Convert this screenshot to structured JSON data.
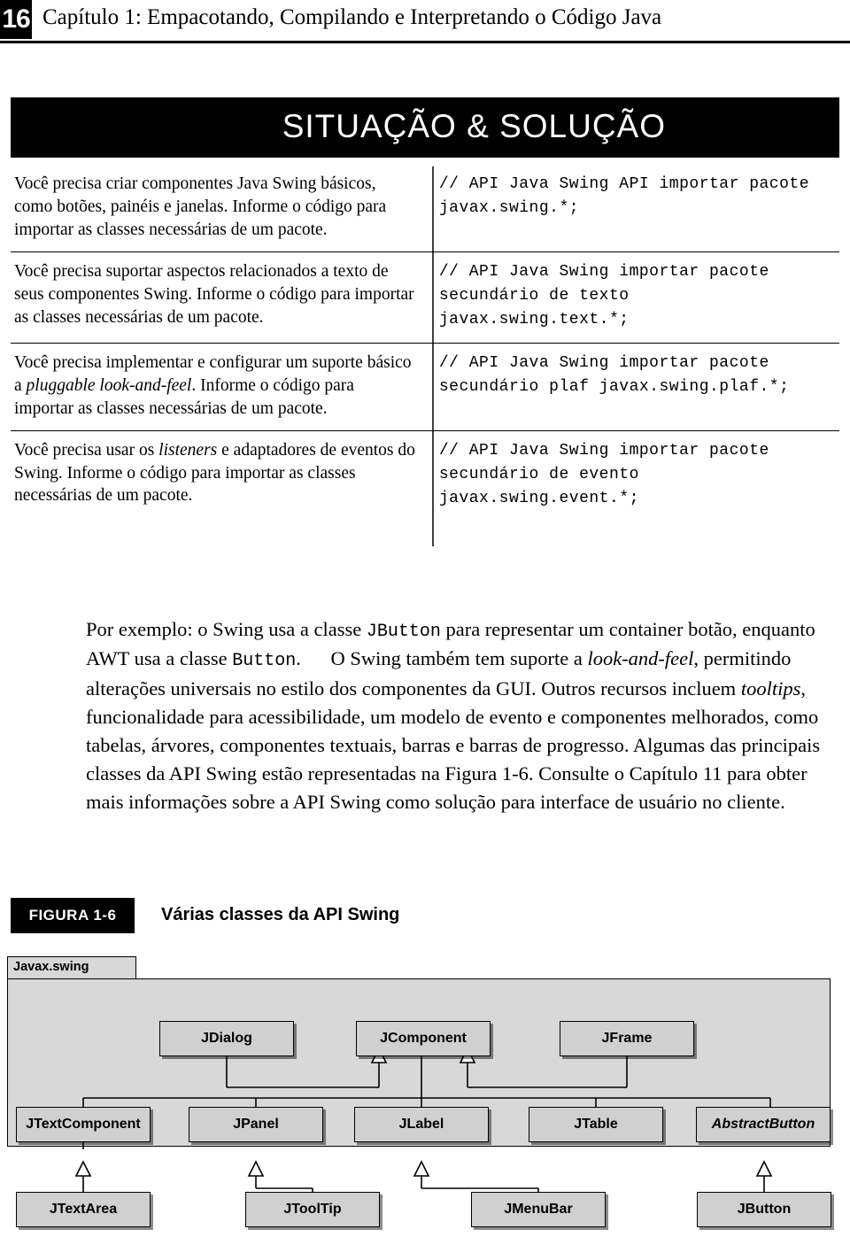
{
  "header": {
    "page_number": "16",
    "chapter_title": "Capítulo 1: Empacotando, Compilando e Interpretando o Código Java"
  },
  "situation_solution": {
    "banner_title": "SITUAÇÃO & SOLUÇÃO",
    "rows": [
      {
        "situation": "Você precisa criar componentes Java Swing básicos, como botões, painéis e janelas. Informe o código para importar as classes necessárias de um pacote.",
        "solution": "// API Java Swing API importar pacote javax.swing.*;"
      },
      {
        "situation": "Você precisa suportar aspectos relacionados a texto de seus componentes Swing. Informe o código para importar as classes necessárias de um pacote.",
        "solution": "// API Java Swing importar pacote secundário de texto javax.swing.text.*;"
      },
      {
        "situation": "Você precisa implementar e configurar um suporte básico a pluggable look-and-feel. Informe o código para importar as classes necessárias de um pacote.",
        "solution": "// API Java Swing importar pacote secundário plaf javax.swing.plaf.*;"
      },
      {
        "situation": "Você precisa usar os listeners e adaptadores de eventos do Swing. Informe o código para importar as classes necessárias de um pacote.",
        "solution": "// API Java Swing importar pacote secundário de evento javax.swing.event.*;"
      }
    ]
  },
  "body": {
    "paragraph": "Por exemplo: o Swing usa a classe JButton para representar um container botão, enquanto AWT usa a classe Button. O Swing também tem suporte a look-and-feel, permitindo alterações universais no estilo dos componentes da GUI. Outros recursos incluem tooltips, funcionalidade para acessibilidade, um modelo de evento e componentes melhorados, como tabelas, árvores, componentes textuais, barras e barras de progresso. Algumas das principais classes da API Swing estão representadas na Figura 1-6. Consulte o Capítulo 11 para obter mais informações sobre a API Swing como solução para interface de usuário no cliente."
  },
  "figure": {
    "label": "FIGURA 1-6",
    "caption": "Várias classes da API Swing",
    "package_label": "Javax.swing",
    "nodes": [
      {
        "id": "jdialog",
        "label": "JDialog"
      },
      {
        "id": "jcomponent",
        "label": "JComponent"
      },
      {
        "id": "jframe",
        "label": "JFrame"
      },
      {
        "id": "jtextcomponent",
        "label": "JTextComponent"
      },
      {
        "id": "jpanel",
        "label": "JPanel"
      },
      {
        "id": "jlabel",
        "label": "JLabel"
      },
      {
        "id": "jtable",
        "label": "JTable"
      },
      {
        "id": "abstractbutton",
        "label": "AbstractButton"
      },
      {
        "id": "jtextarea",
        "label": "JTextArea"
      },
      {
        "id": "jtooltip",
        "label": "JToolTip"
      },
      {
        "id": "jmenubar",
        "label": "JMenuBar"
      },
      {
        "id": "jbutton",
        "label": "JButton"
      }
    ]
  },
  "colors": {
    "banner_bg": "#000000",
    "node_fill": "#d0d0d0",
    "package_fill": "#d8d8d8"
  }
}
